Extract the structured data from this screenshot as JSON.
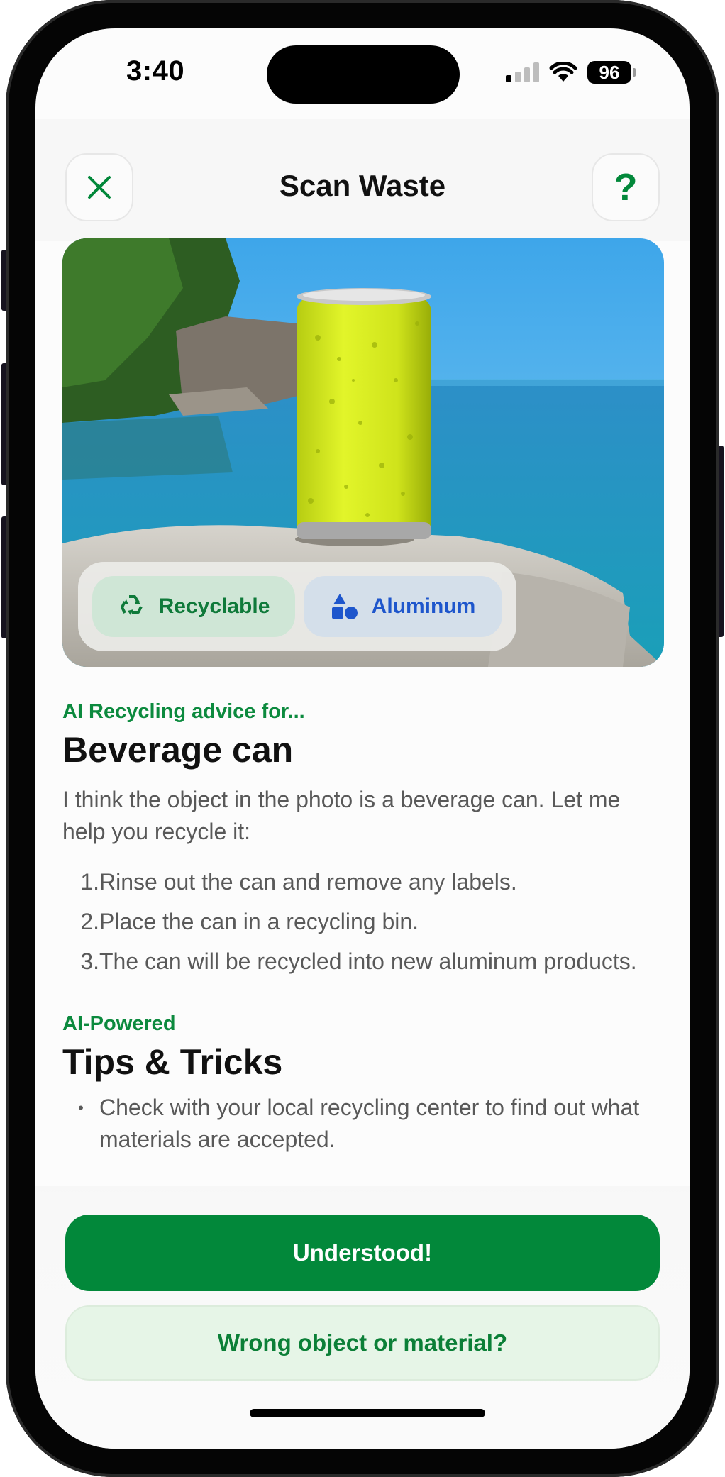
{
  "status_bar": {
    "time": "3:40",
    "battery": "96"
  },
  "header": {
    "title": "Scan Waste",
    "close_icon": "close-icon",
    "help_label": "?"
  },
  "photo": {
    "description_icon": "beverage-can-photo",
    "tags": [
      {
        "label": "Recyclable",
        "icon": "recycle-icon",
        "color": "#0f7a3a",
        "bg": "#cfe6d6"
      },
      {
        "label": "Aluminum",
        "icon": "shapes-icon",
        "color": "#1e56cc",
        "bg": "#d4dfea"
      }
    ]
  },
  "advice": {
    "eyebrow": "AI Recycling advice for...",
    "title": "Beverage can",
    "intro": "I think the object in the photo is a beverage can. Let me help you recycle it:",
    "steps": [
      {
        "num": "1.",
        "text": "Rinse out the can and remove any labels."
      },
      {
        "num": "2.",
        "text": "Place the can in a recycling bin."
      },
      {
        "num": "3.",
        "text": "The can will be recycled into new aluminum products."
      }
    ]
  },
  "tips": {
    "eyebrow": "AI-Powered",
    "title": "Tips & Tricks",
    "items": [
      "Check with your local recycling center to find out what materials are accepted."
    ]
  },
  "actions": {
    "primary": "Understood!",
    "secondary": "Wrong object or material?"
  },
  "colors": {
    "accent": "#02883a",
    "accent_light": "#e6f5e7",
    "material_blue": "#1e56cc"
  }
}
